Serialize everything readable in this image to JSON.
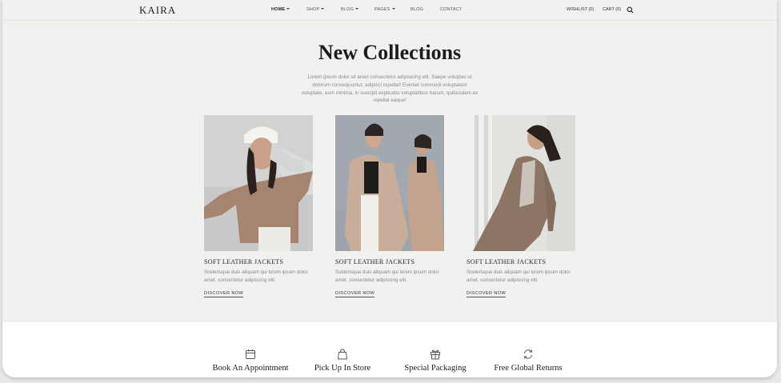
{
  "brand": {
    "logo": "KAIRA"
  },
  "nav": {
    "items": [
      {
        "label": "HOME",
        "dropdown": true
      },
      {
        "label": "SHOP",
        "dropdown": true
      },
      {
        "label": "BLOG",
        "dropdown": true
      },
      {
        "label": "PAGES",
        "dropdown": true
      },
      {
        "label": "BLOG",
        "dropdown": false
      },
      {
        "label": "CONTACT",
        "dropdown": false
      }
    ],
    "wishlist": "WISHLIST (0)",
    "cart": "CART (0)",
    "search_icon": "search-icon"
  },
  "hero": {
    "title": "New Collections",
    "intro": "Lorem ipsum dolor sit amet consectetur adipisicing elit. Saepe voluptas ut dolorum consequuntur, adipisci repellat! Eveniet commodi voluptatem voluptate, eum minima, in suscipit explicabo voluptatibus harum, quibusdam ex repellat eaque!"
  },
  "products": [
    {
      "title": "SOFT LEATHER JACKETS",
      "desc": "Scelerisque duis aliquam qui lorem ipsum dolor amet, consectetur adipiscing elit.",
      "cta": "DISCOVER NOW"
    },
    {
      "title": "SOFT LEATHER JACKETS",
      "desc": "Scelerisque duis aliquam qui lorem ipsum dolor amet, consectetur adipiscing elit.",
      "cta": "DISCOVER NOW"
    },
    {
      "title": "SOFT LEATHER JACKETS",
      "desc": "Scelerisque duis aliquam qui lorem ipsum dolor amet, consectetur adipiscing elit.",
      "cta": "DISCOVER NOW"
    }
  ],
  "features": [
    {
      "label": "Book An Appointment",
      "icon": "calendar-icon"
    },
    {
      "label": "Pick Up In Store",
      "icon": "shopping-bag-icon"
    },
    {
      "label": "Special Packaging",
      "icon": "gift-icon"
    },
    {
      "label": "Free Global Returns",
      "icon": "refresh-icon"
    }
  ],
  "colors": {
    "background": "#f1f1ef",
    "text": "#222222",
    "muted": "#8a8a8a"
  }
}
